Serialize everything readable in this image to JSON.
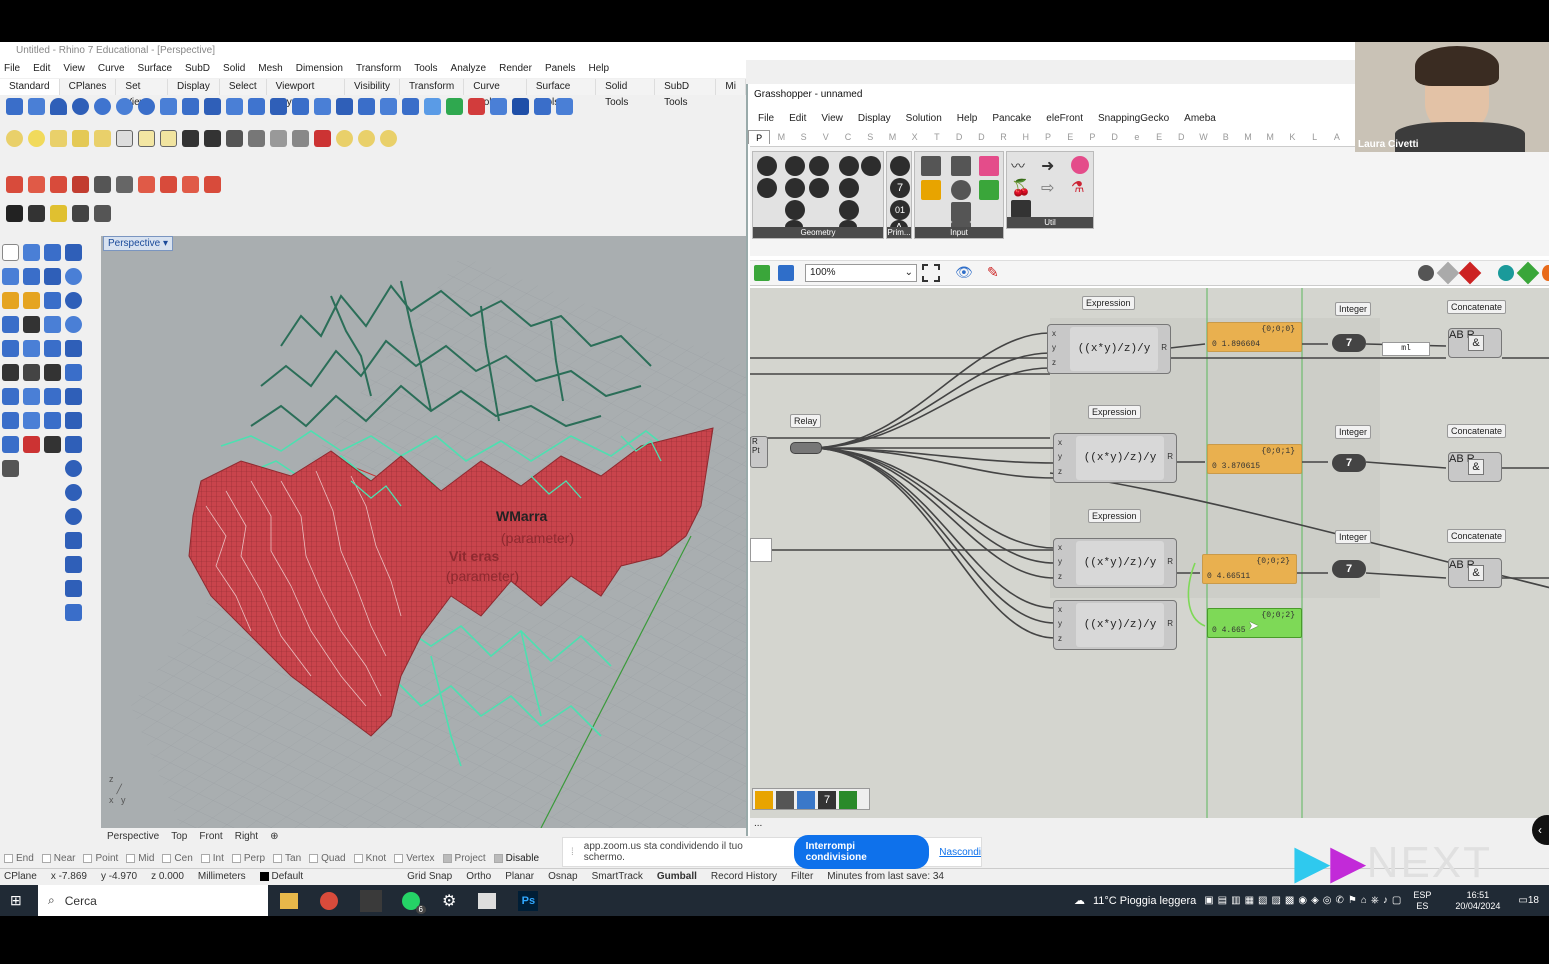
{
  "rhino": {
    "title": "Untitled - Rhino 7 Educational - [Perspective]",
    "menu": [
      "File",
      "Edit",
      "View",
      "Curve",
      "Surface",
      "SubD",
      "Solid",
      "Mesh",
      "Dimension",
      "Transform",
      "Tools",
      "Analyze",
      "Render",
      "Panels",
      "Help"
    ],
    "tabs": [
      "Standard",
      "CPlanes",
      "Set View",
      "Display",
      "Select",
      "Viewport Layout",
      "Visibility",
      "Transform",
      "Curve Tools",
      "Surface Tools",
      "Solid Tools",
      "SubD Tools",
      "Mi"
    ],
    "viewport_label": "Perspective",
    "viewport_tabs": [
      "Perspective",
      "Top",
      "Front",
      "Right"
    ],
    "osnaps": [
      "End",
      "Near",
      "Point",
      "Mid",
      "Cen",
      "Int",
      "Perp",
      "Tan",
      "Quad",
      "Knot",
      "Vertex",
      "Project"
    ],
    "osnap_disable": "Disable",
    "status": {
      "cplane": "CPlane",
      "x": "x -7.869",
      "y": "y -4.970",
      "z": "z 0.000",
      "units": "Millimeters",
      "layer": "Default",
      "grid_snap": "Grid Snap",
      "ortho": "Ortho",
      "planar": "Planar",
      "osnap": "Osnap",
      "smarttrack": "SmartTrack",
      "gumball": "Gumball",
      "record_history": "Record History",
      "filter": "Filter",
      "autosave": "Minutes from last save: 34"
    }
  },
  "grasshopper": {
    "title": "Grasshopper - unnamed",
    "menu": [
      "File",
      "Edit",
      "View",
      "Display",
      "Solution",
      "Help",
      "Pancake",
      "eleFront",
      "SnappingGecko",
      "Ameba"
    ],
    "tabs": [
      "P",
      "M",
      "S",
      "V",
      "C",
      "S",
      "M",
      "X",
      "T",
      "D",
      "D",
      "R",
      "H",
      "P",
      "E",
      "P",
      "D",
      "e",
      "E",
      "D",
      "W",
      "B",
      "M",
      "M",
      "K",
      "L",
      "A"
    ],
    "ribbon_panels": [
      "Geometry",
      "Prim...",
      "Input",
      "Util"
    ],
    "zoom": "100%",
    "components": {
      "expression_label": "Expression",
      "expression_formula": "((x*y)/z)/y",
      "relay_label": "Relay",
      "integer_label": "Integer",
      "concat_label": "Concatenate",
      "integer_value": "7",
      "text_ml": "ml"
    },
    "panels": [
      {
        "path": "{0;0;0}",
        "value": "0 1.896604"
      },
      {
        "path": "{0;0;1}",
        "value": "0 3.870615"
      },
      {
        "path": "{0;0;2}",
        "value": "0 4.66511"
      },
      {
        "path": "{0;0;2}",
        "value": "0 4.665"
      }
    ],
    "footer": "..."
  },
  "webcam": {
    "name": "Laura Civetti"
  },
  "zoom_share": {
    "message": "app.zoom.us sta condividendo il tuo schermo.",
    "stop": "Interrompi condivisione",
    "hide": "Nascondi"
  },
  "logo": "NEXT",
  "taskbar": {
    "search": "Cerca",
    "weather": "11°C  Pioggia leggera",
    "lang": "ESP",
    "lang2": "ES",
    "time": "16:51",
    "date": "20/04/2024",
    "notif": "18",
    "whatsapp_badge": "6"
  },
  "viewport_text": {
    "tag1": "WMarra",
    "tag2": "(parameter)",
    "tag3": "Vit eras",
    "tag4": "(parameter)"
  },
  "colors": {
    "mesh": "#c9444c",
    "curves_green": "#4de0b0",
    "curves_dark": "#2b6e58",
    "panel_orange": "#e9b04f",
    "panel_green": "#7ed957",
    "zoom_blue": "#0e71eb"
  }
}
